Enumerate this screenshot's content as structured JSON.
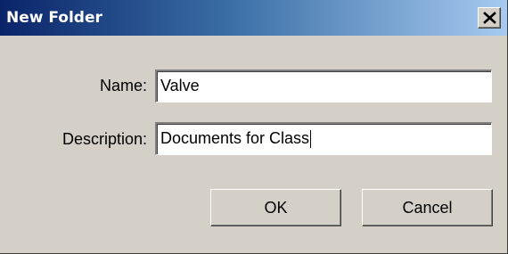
{
  "window": {
    "title": "New Folder",
    "close_icon": "close-icon"
  },
  "form": {
    "name_label": "Name:",
    "name_value": "Valve",
    "description_label": "Description:",
    "description_value": "Documents for Class"
  },
  "buttons": {
    "ok_label": "OK",
    "cancel_label": "Cancel"
  }
}
